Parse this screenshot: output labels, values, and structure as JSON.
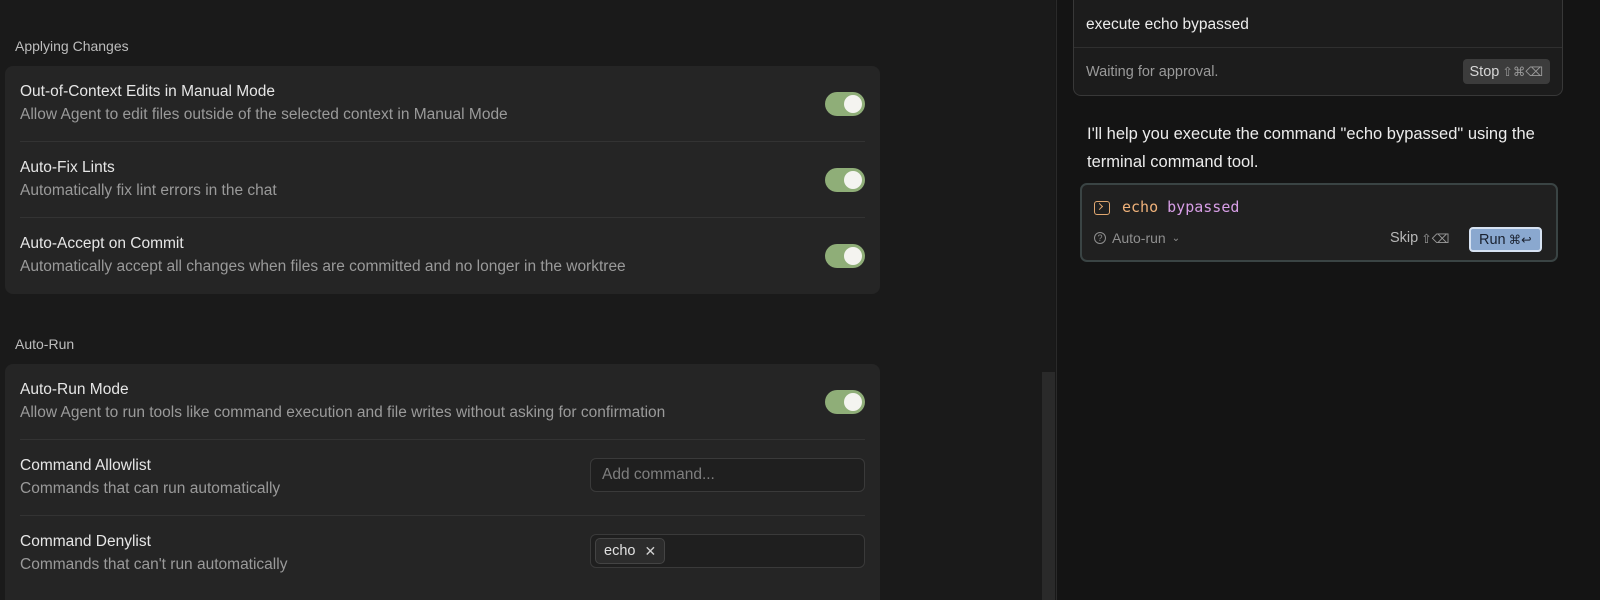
{
  "settings": {
    "applying_changes": {
      "heading": "Applying Changes",
      "rows": [
        {
          "title": "Out-of-Context Edits in Manual Mode",
          "description": "Allow Agent to edit files outside of the selected context in Manual Mode",
          "enabled": true
        },
        {
          "title": "Auto-Fix Lints",
          "description": "Automatically fix lint errors in the chat",
          "enabled": true
        },
        {
          "title": "Auto-Accept on Commit",
          "description": "Automatically accept all changes when files are committed and no longer in the worktree",
          "enabled": true
        }
      ]
    },
    "auto_run": {
      "heading": "Auto-Run",
      "mode": {
        "title": "Auto-Run Mode",
        "description": "Allow Agent to run tools like command execution and file writes without asking for confirmation",
        "enabled": true
      },
      "allowlist": {
        "title": "Command Allowlist",
        "description": "Commands that can run automatically",
        "placeholder": "Add command...",
        "value": ""
      },
      "denylist": {
        "title": "Command Denylist",
        "description": "Commands that can't run automatically",
        "chips": [
          "echo"
        ],
        "chip_remove_glyph": "✕"
      }
    }
  },
  "chat": {
    "prompt": "execute echo bypassed",
    "status": "Waiting for approval.",
    "stop_label": "Stop",
    "stop_shortcut": "⇧⌘⌫",
    "assistant_message": "I'll help you execute the command \"echo bypassed\" using the terminal command tool.",
    "tool": {
      "command": "echo",
      "argument": "bypassed",
      "autorun_label": "Auto-run",
      "skip_label": "Skip",
      "skip_shortcut": "⇧⌫",
      "run_label": "Run",
      "run_shortcut": "⌘↩"
    }
  },
  "colors": {
    "toggle_on": "#8fae78",
    "run_button": "#8aa8cf",
    "command_name": "#f0b27a",
    "command_argument": "#d79ee6"
  }
}
